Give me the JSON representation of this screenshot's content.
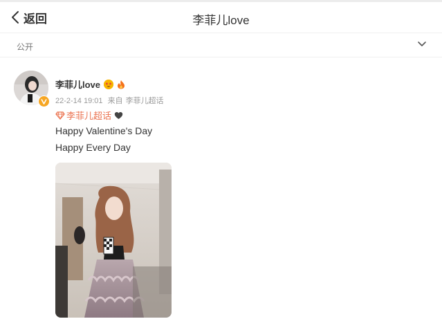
{
  "header": {
    "back_label": "返回",
    "title": "李菲儿love"
  },
  "privacy": {
    "label": "公开"
  },
  "post": {
    "username": "李菲儿love",
    "date": "22-2-14 19:01",
    "source_prefix": "来自",
    "source": "李菲儿超话",
    "topic": "李菲儿超话",
    "lines": [
      "Happy Valentine's Day",
      "Happy Every Day"
    ]
  },
  "colors": {
    "accent": "#eb7350",
    "verified": "#f6a623",
    "meta_text": "#999999"
  },
  "icons": {
    "back": "chevron-left-icon",
    "expand": "chevron-down-icon",
    "verified": "verified-badge-icon",
    "emoji": "star-eyes-emoji-icon",
    "fire": "fire-icon",
    "topic": "diamond-icon",
    "heart": "black-heart-icon"
  }
}
